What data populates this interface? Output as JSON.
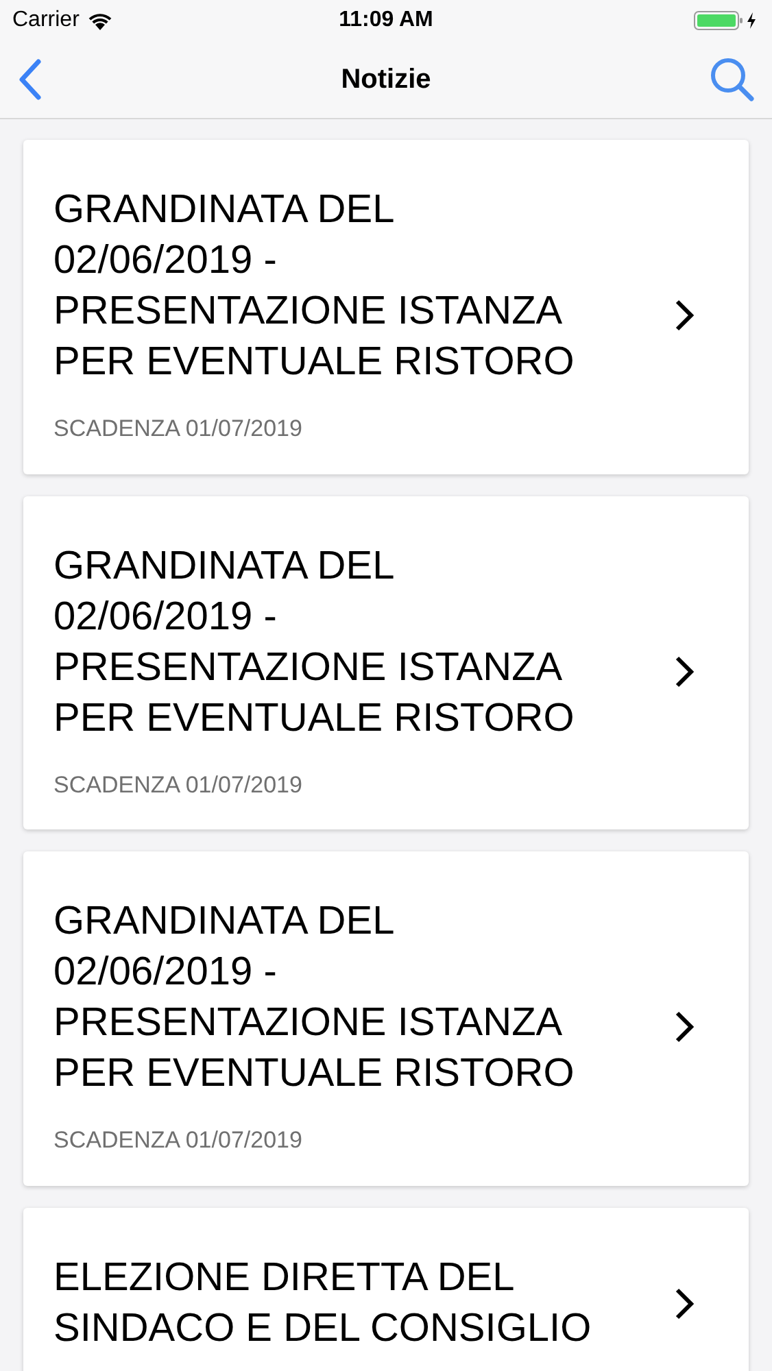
{
  "status_bar": {
    "carrier": "Carrier",
    "time": "11:09 AM"
  },
  "nav": {
    "title": "Notizie"
  },
  "news": [
    {
      "title": "GRANDINATA DEL 02/06/2019 - PRESENTAZIONE ISTANZA PER EVENTUALE RISTORO",
      "deadline": "SCADENZA 01/07/2019"
    },
    {
      "title": "GRANDINATA DEL 02/06/2019 - PRESENTAZIONE ISTANZA PER EVENTUALE RISTORO",
      "deadline": "SCADENZA 01/07/2019"
    },
    {
      "title": "GRANDINATA DEL 02/06/2019 - PRESENTAZIONE ISTANZA PER EVENTUALE RISTORO",
      "deadline": "SCADENZA 01/07/2019"
    },
    {
      "title": "ELEZIONE DIRETTA DEL SINDACO E DEL CONSIGLIO"
    }
  ]
}
